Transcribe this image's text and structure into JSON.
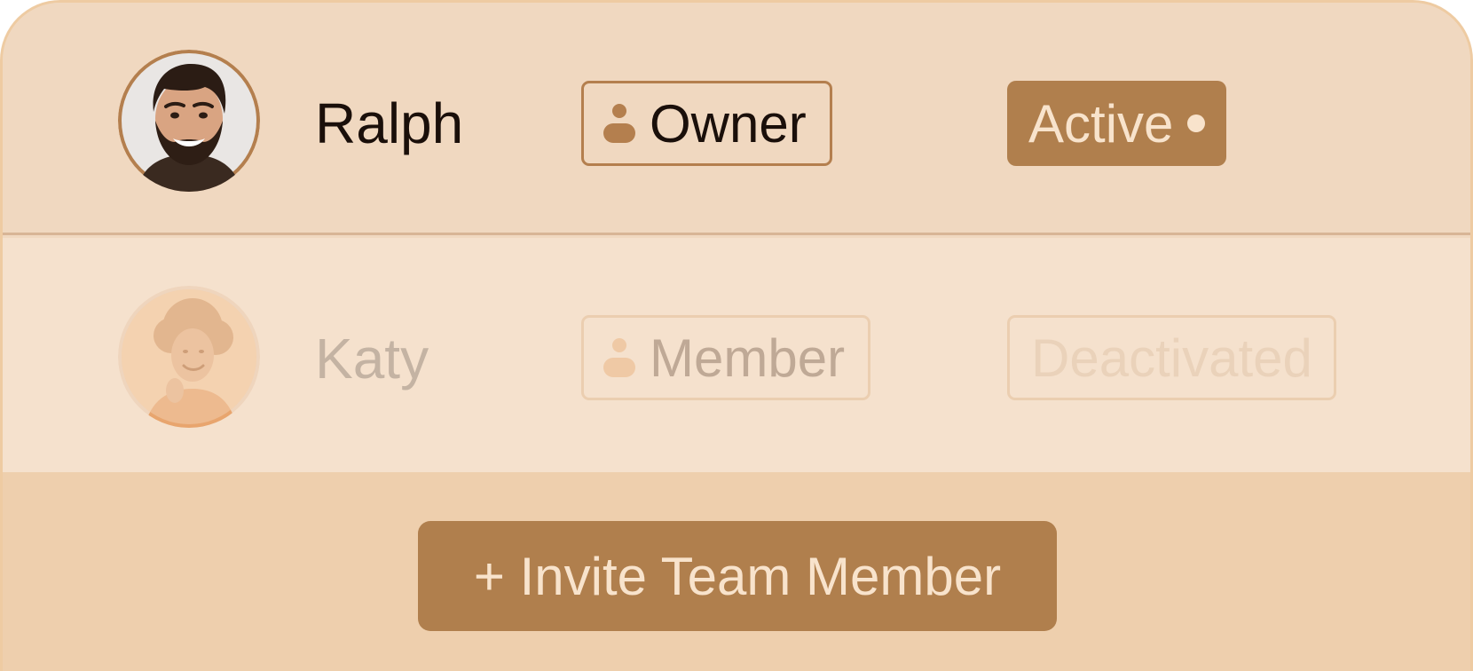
{
  "members": [
    {
      "name": "Ralph",
      "role": "Owner",
      "role_icon": "user-icon",
      "status": "Active",
      "status_indicator": "dot-icon"
    },
    {
      "name": "Katy",
      "role": "Member",
      "role_icon": "user-icon",
      "status": "Deactivated"
    }
  ],
  "footer": {
    "invite_label": "+ Invite Team Member"
  },
  "colors": {
    "accent": "#b07f4d",
    "card_background": "#f0d8c0",
    "deactivated_row_background": "#f5e1cd",
    "footer_background": "#eecfad",
    "text_dark": "#1a0f0a",
    "text_light": "#f8e3cc"
  }
}
